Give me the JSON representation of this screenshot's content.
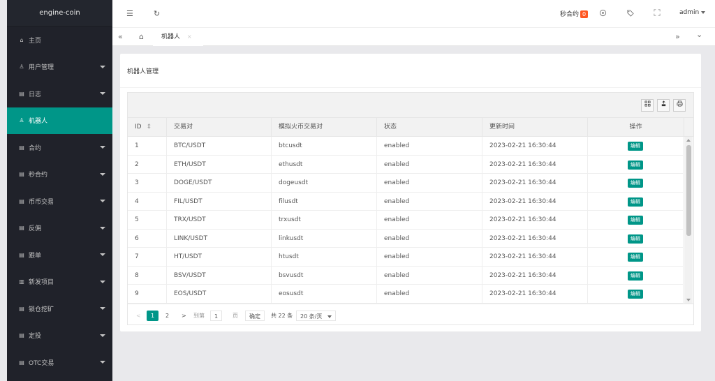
{
  "sidebar": {
    "logo": "engine-coin",
    "items": [
      {
        "label": "主页",
        "icon": "home-icon",
        "glyph": "⌂",
        "has_caret": false,
        "active": false
      },
      {
        "label": "用户管理",
        "icon": "user-icon",
        "glyph": "♙",
        "has_caret": true,
        "active": false
      },
      {
        "label": "日志",
        "icon": "file-icon",
        "glyph": "▤",
        "has_caret": true,
        "active": false
      },
      {
        "label": "机器人",
        "icon": "user-icon",
        "glyph": "♙",
        "has_caret": false,
        "active": true
      },
      {
        "label": "合约",
        "icon": "file-icon",
        "glyph": "▤",
        "has_caret": true,
        "active": false
      },
      {
        "label": "秒合约",
        "icon": "file-icon",
        "glyph": "▤",
        "has_caret": true,
        "active": false
      },
      {
        "label": "币币交易",
        "icon": "file-icon",
        "glyph": "▤",
        "has_caret": true,
        "active": false
      },
      {
        "label": "反佣",
        "icon": "file-icon",
        "glyph": "▤",
        "has_caret": true,
        "active": false
      },
      {
        "label": "跟单",
        "icon": "file-icon",
        "glyph": "▤",
        "has_caret": true,
        "active": false
      },
      {
        "label": "新发项目",
        "icon": "columns-icon",
        "glyph": "▥",
        "has_caret": true,
        "active": false
      },
      {
        "label": "锁仓挖矿",
        "icon": "file-icon",
        "glyph": "▤",
        "has_caret": true,
        "active": false
      },
      {
        "label": "定投",
        "icon": "file-icon",
        "glyph": "▤",
        "has_caret": true,
        "active": false
      },
      {
        "label": "OTC交易",
        "icon": "file-icon",
        "glyph": "▤",
        "has_caret": true,
        "active": false
      }
    ]
  },
  "header": {
    "menu_glyph": "☰",
    "refresh_glyph": "↻",
    "notice_label": "秒合约",
    "notice_count": "0",
    "user": "admin"
  },
  "tabs": {
    "prev_glyph": "«",
    "home_glyph": "⌂",
    "active_label": "机器人",
    "close_glyph": "×",
    "next_glyph": "»",
    "more_glyph": "⌄"
  },
  "page": {
    "title": "机器人管理"
  },
  "table": {
    "columns": [
      "ID",
      "交易对",
      "模拟火币交易对",
      "状态",
      "更新时间",
      "操作"
    ],
    "sort_glyph": "⇕",
    "edit_label": "编辑",
    "rows": [
      {
        "id": "1",
        "pair": "BTC/USDT",
        "huobi": "btcusdt",
        "status": "enabled",
        "updated": "2023-02-21 16:30:44"
      },
      {
        "id": "2",
        "pair": "ETH/USDT",
        "huobi": "ethusdt",
        "status": "enabled",
        "updated": "2023-02-21 16:30:44"
      },
      {
        "id": "3",
        "pair": "DOGE/USDT",
        "huobi": "dogeusdt",
        "status": "enabled",
        "updated": "2023-02-21 16:30:44"
      },
      {
        "id": "4",
        "pair": "FIL/USDT",
        "huobi": "filusdt",
        "status": "enabled",
        "updated": "2023-02-21 16:30:44"
      },
      {
        "id": "5",
        "pair": "TRX/USDT",
        "huobi": "trxusdt",
        "status": "enabled",
        "updated": "2023-02-21 16:30:44"
      },
      {
        "id": "6",
        "pair": "LINK/USDT",
        "huobi": "linkusdt",
        "status": "enabled",
        "updated": "2023-02-21 16:30:44"
      },
      {
        "id": "7",
        "pair": "HT/USDT",
        "huobi": "htusdt",
        "status": "enabled",
        "updated": "2023-02-21 16:30:44"
      },
      {
        "id": "8",
        "pair": "BSV/USDT",
        "huobi": "bsvusdt",
        "status": "enabled",
        "updated": "2023-02-21 16:30:44"
      },
      {
        "id": "9",
        "pair": "EOS/USDT",
        "huobi": "eosusdt",
        "status": "enabled",
        "updated": "2023-02-21 16:30:44"
      }
    ]
  },
  "pager": {
    "prev_glyph": "<",
    "current": "1",
    "page2": "2",
    "next_glyph": ">",
    "goto_label": "到第",
    "goto_value": "1",
    "page_unit": "页",
    "confirm": "确定",
    "total": "共 22 条",
    "per_page": "20 条/页"
  },
  "colors": {
    "accent": "#009688",
    "badge": "#ff5722",
    "sidebar_bg": "#20222a"
  }
}
